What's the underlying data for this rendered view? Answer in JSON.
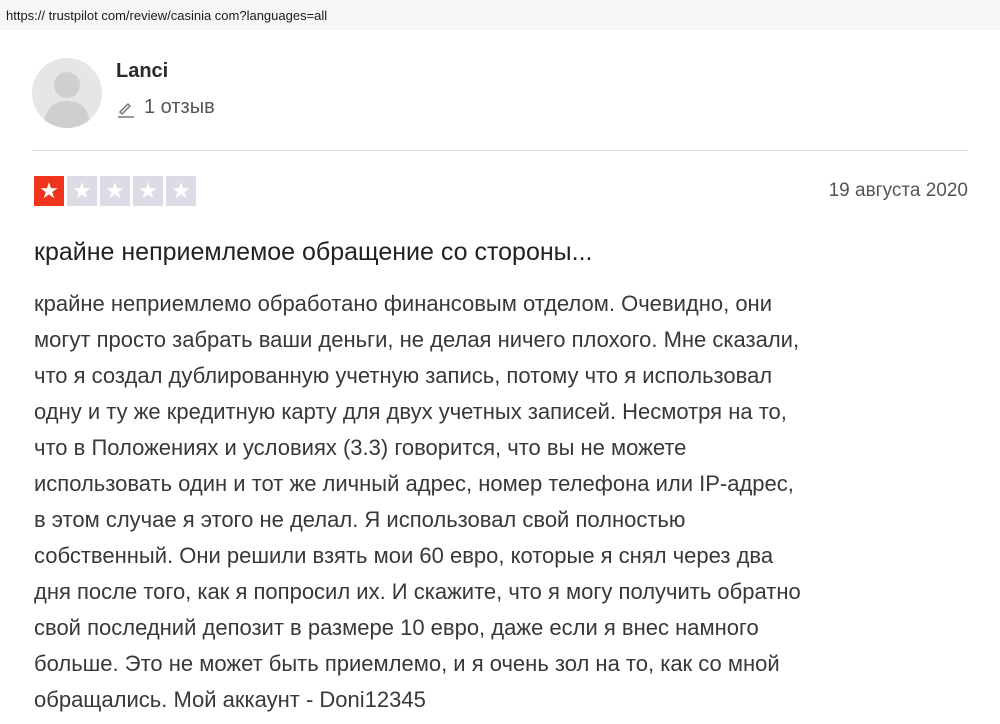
{
  "address_bar": {
    "url": "https:// trustpilot com/review/casinia com?languages=all"
  },
  "reviewer": {
    "name": "Lanci",
    "review_count": "1 отзыв",
    "avatar_icon": "user-silhouette-icon",
    "count_icon": "pencil-icon"
  },
  "review": {
    "rating": 1,
    "rating_max": 5,
    "star_color_active": "#f0341d",
    "star_color_inactive": "#dcdce6",
    "date": "19 августа 2020",
    "title": "крайне неприемлемое обращение со стороны...",
    "body": "крайне неприемлемо обработано финансовым отделом. Очевидно, они\nмогут просто забрать ваши деньги, не делая ничего плохого. Мне сказали,\nчто я создал дублированную учетную запись, потому что я использовал\nодну и ту же кредитную карту для двух учетных записей. Несмотря на то,\nчто в Положениях и условиях (3.3) говорится, что вы не можете\nиспользовать один и тот же личный адрес, номер телефона или IP-адрес,\nв этом случае я этого не делал. Я использовал свой полностью\nсобственный. Они решили взять мои 60 евро, которые я снял через два\nдня после того, как я попросил их. И скажите, что я могу получить обратно\nсвой последний депозит в размере 10 евро, даже если я внес намного\nбольше. Это не может быть приемлемо, и я очень зол на то, как со мной\nобращались. Мой аккаунт - Doni12345"
  }
}
